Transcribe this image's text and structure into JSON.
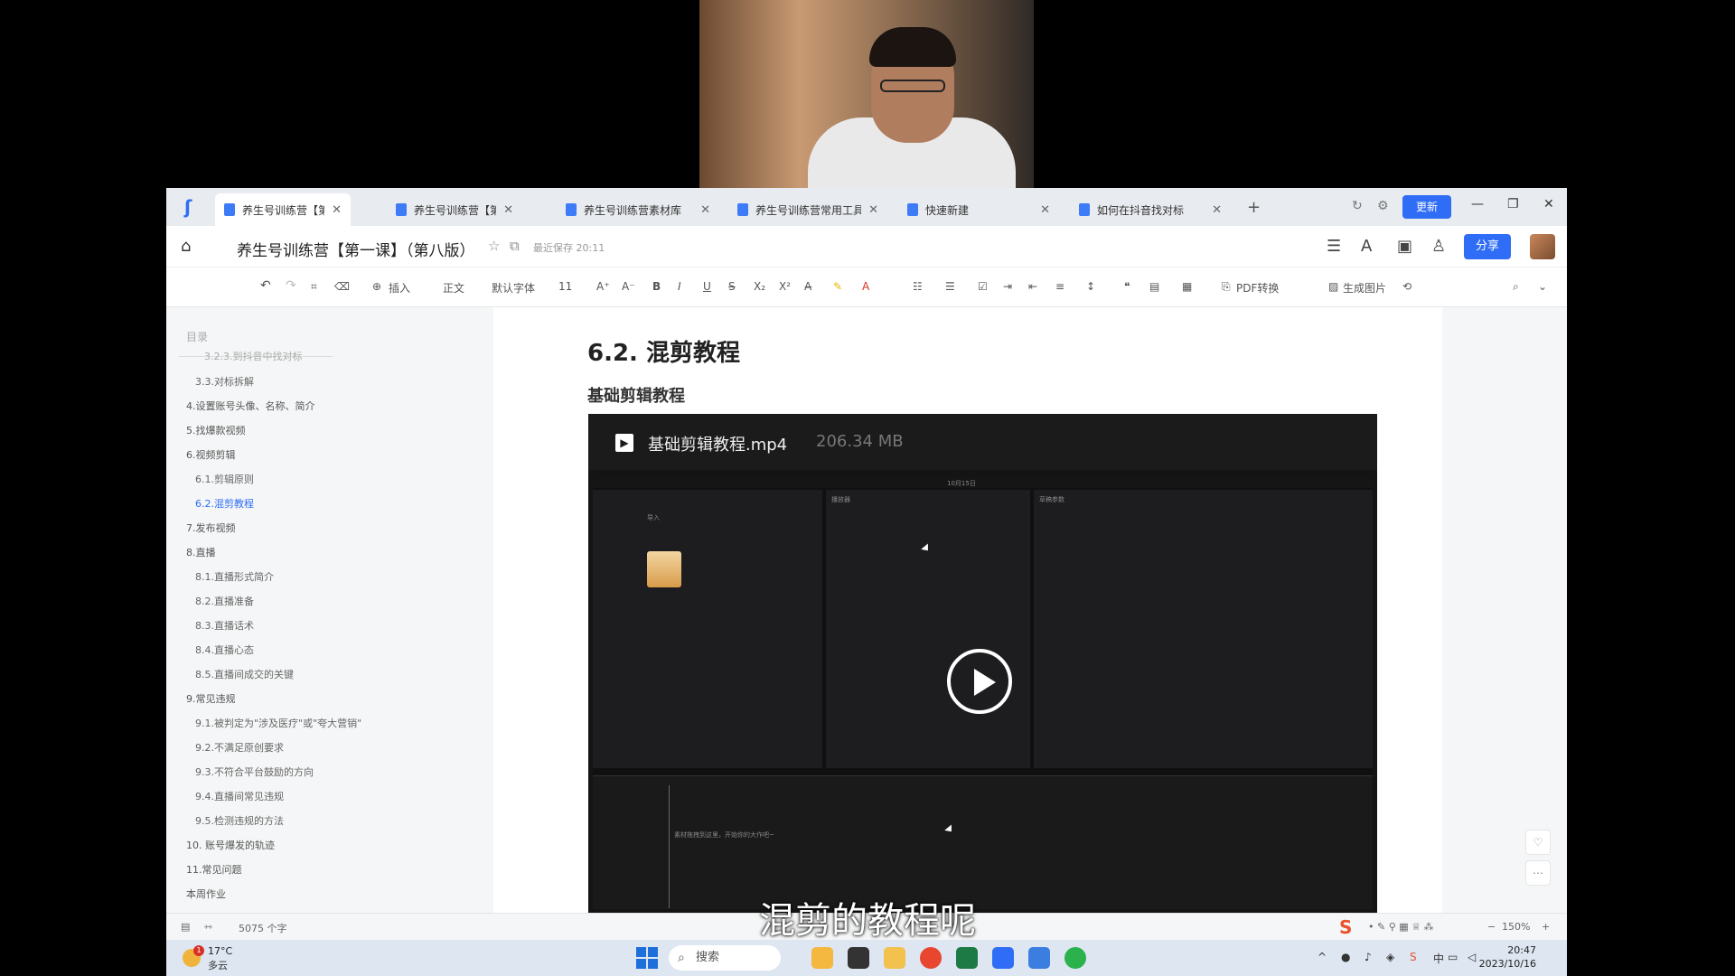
{
  "subtitle": "混剪的教程呢",
  "tabs": [
    {
      "label": "养生号训练营【第一课】...",
      "active": true
    },
    {
      "label": "养生号训练营【第一课】...",
      "active": false
    },
    {
      "label": "养生号训练营素材库",
      "active": false
    },
    {
      "label": "养生号训练营常用工具",
      "active": false
    },
    {
      "label": "快速新建",
      "active": false
    },
    {
      "label": "如何在抖音找对标",
      "active": false
    }
  ],
  "window": {
    "update_label": "更新"
  },
  "header": {
    "doc_title": "养生号训练营【第一课】（第八版）",
    "save_status": "最近保存 20:11",
    "share_label": "分享"
  },
  "toolbar": {
    "insert": "插入",
    "style": "正文",
    "font": "默认字体",
    "font_size": "11",
    "pdf_convert": "PDF转换",
    "gen_image": "生成图片"
  },
  "toc": {
    "title": "目录",
    "items": [
      {
        "label": "3.2.3.到抖音中找对标",
        "level": 2
      },
      {
        "label": "3.3.对标拆解",
        "level": 2
      },
      {
        "label": "4.设置账号头像、名称、简介",
        "level": 1
      },
      {
        "label": "5.找爆款视频",
        "level": 1
      },
      {
        "label": "6.视频剪辑",
        "level": 1
      },
      {
        "label": "6.1.剪辑原则",
        "level": 2
      },
      {
        "label": "6.2.混剪教程",
        "level": 2,
        "active": true
      },
      {
        "label": "7.发布视频",
        "level": 1
      },
      {
        "label": "8.直播",
        "level": 1
      },
      {
        "label": "8.1.直播形式简介",
        "level": 2
      },
      {
        "label": "8.2.直播准备",
        "level": 2
      },
      {
        "label": "8.3.直播话术",
        "level": 2
      },
      {
        "label": "8.4.直播心态",
        "level": 2
      },
      {
        "label": "8.5.直播间成交的关键",
        "level": 2
      },
      {
        "label": "9.常见违规",
        "level": 1
      },
      {
        "label": "9.1.被判定为\"涉及医疗\"或\"夸大营销\"",
        "level": 2
      },
      {
        "label": "9.2.不满足原创要求",
        "level": 2
      },
      {
        "label": "9.3.不符合平台鼓励的方向",
        "level": 2
      },
      {
        "label": "9.4.直播间常见违规",
        "level": 2
      },
      {
        "label": "9.5.检测违规的方法",
        "level": 2
      },
      {
        "label": "10. 账号爆发的轨迹",
        "level": 1
      },
      {
        "label": "11.常见问题",
        "level": 1
      },
      {
        "label": "本周作业",
        "level": 1
      }
    ]
  },
  "content": {
    "section_heading": "6.2. 混剪教程",
    "sub_heading": "基础剪辑教程",
    "video": {
      "filename": "基础剪辑教程.mp4",
      "size": "206.34 MB",
      "editor_top_label": "10月15日",
      "editor_import_label": "导入",
      "editor_player_label": "播放器",
      "editor_draft_label": "草稿参数",
      "timeline_hint": "素材拖拽到这里，开始你的大作吧~"
    }
  },
  "statusbar": {
    "word_count": "5075 个字",
    "zoom": "150%"
  },
  "taskbar": {
    "temperature": "17°C",
    "weather": "多云",
    "weather_badge": "1",
    "search_placeholder": "搜索",
    "ime_label": "中",
    "time": "20:47",
    "date": "2023/10/16"
  },
  "colors": {
    "accent": "#2f6df6",
    "toc_active": "#2f6df6"
  }
}
